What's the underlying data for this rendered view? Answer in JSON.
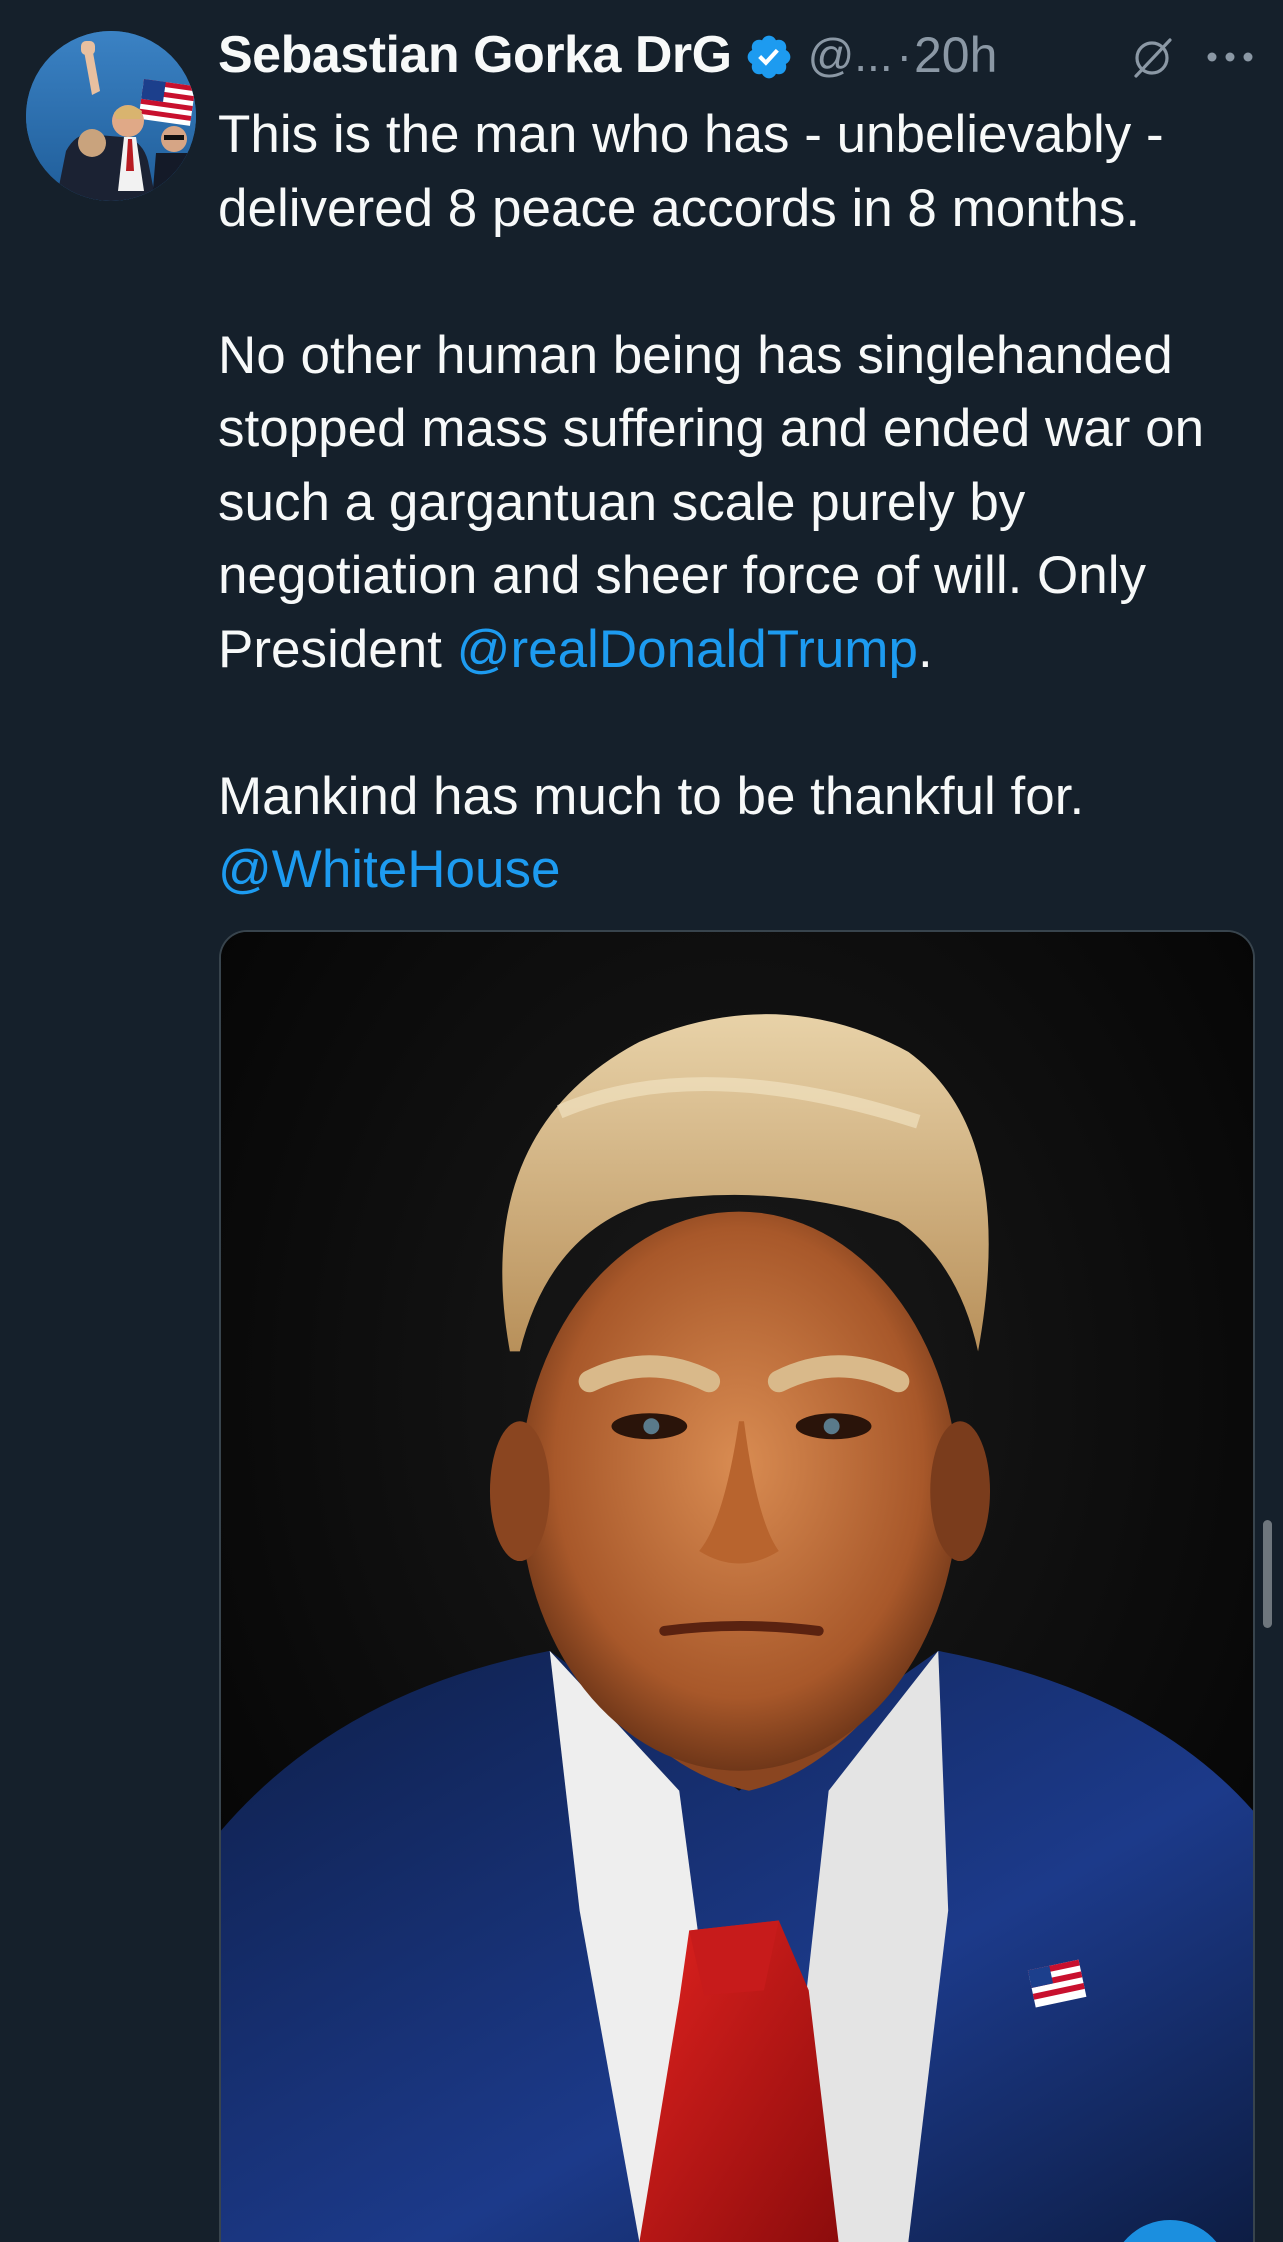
{
  "tweet": {
    "author": {
      "display_name": "Sebastian Gorka DrG",
      "handle": "@...",
      "verified": true,
      "avatar_icon": "profile-photo"
    },
    "separator": "·",
    "timestamp": "20h",
    "text": {
      "p1": "This is the man who has - unbelievably - delivered 8 peace accords in 8 months.",
      "p2_before": "No other human being has singlehanded stopped mass suffering and ended war on such a gargantuan scale purely by negotiation and sheer force of will. Only President ",
      "p2_mention": "@realDonaldTrump",
      "p2_after": ".",
      "p3": "Mankind has much to be thankful for.",
      "p4_mention": "@WhiteHouse"
    },
    "media": {
      "type": "photo",
      "icon": "portrait-photo"
    }
  },
  "icons": {
    "verified": "verified-badge-icon",
    "grok": "grok-icon",
    "more": "more-options-icon"
  },
  "colors": {
    "background": "#15202b",
    "text": "#f7f9f9",
    "secondary": "#8b98a5",
    "accent": "#1d9bf0"
  }
}
